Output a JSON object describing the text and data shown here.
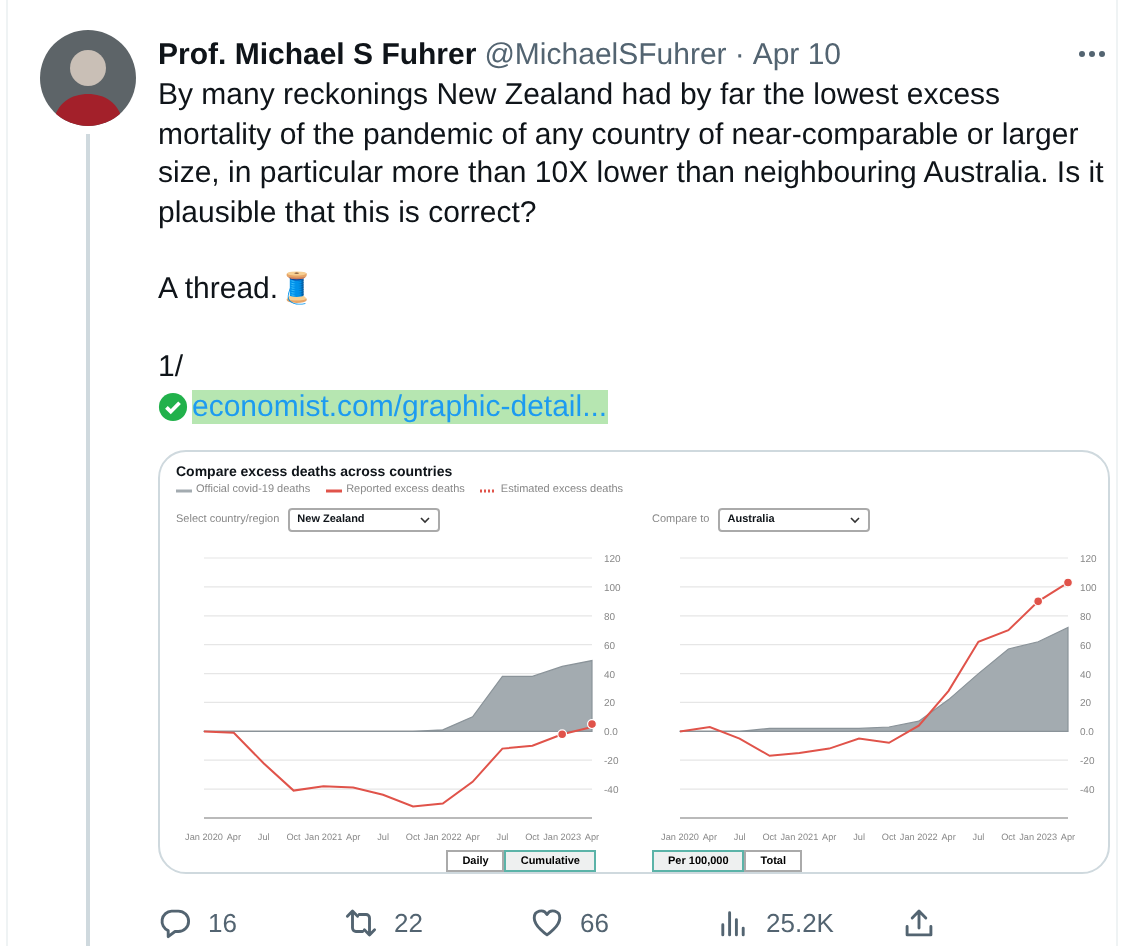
{
  "tweet": {
    "author": "Prof. Michael S Fuhrer",
    "handle": "@MichaelSFuhrer",
    "separator": "·",
    "date": "Apr 10",
    "paragraphs": [
      "By many reckonings New Zealand had by far the lowest excess mortality of the pandemic of any country of near-comparable or larger size, in particular more than 10X lower than neighbouring Australia. Is it plausible that this is correct?",
      "A thread.🧵",
      "1/"
    ],
    "link": "economist.com/graphic-detail...",
    "card": {
      "title": "Compare excess deaths across countries",
      "panels": [
        {
          "select_label": "Select country/region",
          "select_value": "New Zealand",
          "buttons": [
            {
              "label": "Daily",
              "selected": false
            },
            {
              "label": "Cumulative",
              "selected": true
            }
          ],
          "chart_data": {
            "type": "line",
            "grid": true,
            "categories": [
              "Jan 2020",
              "Apr",
              "Jul",
              "Oct",
              "Jan 2021",
              "Apr",
              "Jul",
              "Oct",
              "Jan 2022",
              "Apr",
              "Jul",
              "Oct",
              "Jan 2023",
              "Apr"
            ],
            "ylim": [
              -60,
              120
            ],
            "yticks": [
              -40,
              -20,
              {
                "value": 0,
                "label": "0.0"
              },
              20,
              40,
              60,
              80,
              100,
              120
            ],
            "series": [
              {
                "name": "Official covid-19 deaths",
                "color": "#a3abb0",
                "type": "area",
                "values": [
                  0,
                  0,
                  0,
                  0,
                  0,
                  0,
                  0,
                  0,
                  1,
                  10,
                  38,
                  38,
                  45,
                  49
                ]
              },
              {
                "name": "Reported excess deaths",
                "color": "#e0534a",
                "type": "line",
                "values": [
                  0,
                  -1,
                  -22,
                  -41,
                  -38,
                  -39,
                  -44,
                  -52,
                  -50,
                  -35,
                  -12,
                  -10,
                  -2,
                  3
                ]
              },
              {
                "name": "Estimated excess deaths",
                "color": "#e0534a",
                "type": "scatter",
                "values": [
                  null,
                  null,
                  null,
                  null,
                  null,
                  null,
                  null,
                  null,
                  null,
                  null,
                  null,
                  null,
                  -2,
                  5
                ]
              }
            ]
          }
        },
        {
          "select_label": "Compare to",
          "select_value": "Australia",
          "buttons": [
            {
              "label": "Per 100,000",
              "selected": true
            },
            {
              "label": "Total",
              "selected": false
            }
          ],
          "chart_data": {
            "type": "line",
            "grid": true,
            "categories": [
              "Jan 2020",
              "Apr",
              "Jul",
              "Oct",
              "Jan 2021",
              "Apr",
              "Jul",
              "Oct",
              "Jan 2022",
              "Apr",
              "Jul",
              "Oct",
              "Jan 2023",
              "Apr"
            ],
            "ylim": [
              -60,
              120
            ],
            "yticks": [
              -40,
              -20,
              {
                "value": 0,
                "label": "0.0"
              },
              20,
              40,
              60,
              80,
              100,
              120
            ],
            "series": [
              {
                "color": "#a3abb0",
                "type": "area",
                "values": [
                  0,
                  0,
                  0,
                  2,
                  2,
                  2,
                  2,
                  3,
                  7,
                  22,
                  40,
                  57,
                  62,
                  72
                ]
              },
              {
                "color": "#e0534a",
                "type": "line",
                "values": [
                  0,
                  3,
                  -5,
                  -17,
                  -15,
                  -12,
                  -5,
                  -8,
                  4,
                  28,
                  62,
                  70,
                  90,
                  103
                ]
              },
              {
                "color": "#e0534a",
                "type": "scatter",
                "values": [
                  null,
                  null,
                  null,
                  null,
                  null,
                  null,
                  null,
                  null,
                  null,
                  null,
                  null,
                  null,
                  90,
                  103
                ]
              }
            ]
          }
        }
      ]
    },
    "actions": [
      {
        "kind": "reply",
        "count": "16"
      },
      {
        "kind": "retweet",
        "count": "22"
      },
      {
        "kind": "like",
        "count": "66"
      },
      {
        "kind": "views",
        "count": "25.2K"
      },
      {
        "kind": "share"
      }
    ]
  }
}
